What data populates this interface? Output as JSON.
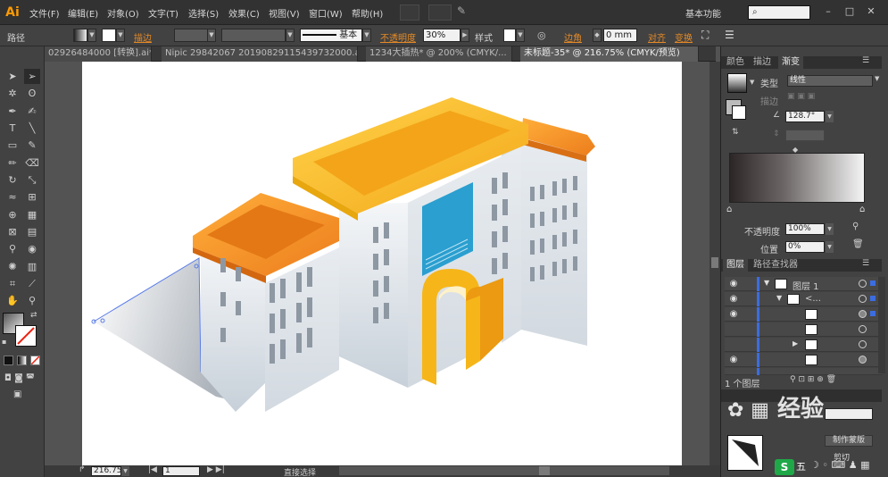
{
  "app": {
    "logo": "Ai",
    "menus": [
      "文件(F)",
      "编辑(E)",
      "对象(O)",
      "文字(T)",
      "选择(S)",
      "效果(C)",
      "视图(V)",
      "窗口(W)",
      "帮助(H)"
    ],
    "workspace": "基本功能",
    "search_placeholder": ""
  },
  "controlbar": {
    "path_label": "路径",
    "stroke_label": "描边",
    "stroke_style": "基本",
    "opacity_label": "不透明度",
    "opacity_value": "30%",
    "style_label": "样式",
    "corner_label": "边角",
    "corner_value": "0 mm",
    "align_label": "对齐",
    "transform_label": "变换"
  },
  "tabs": [
    {
      "label": "02926484000 [转换].ai*",
      "active": false
    },
    {
      "label": "Nipic 29842067 20190829115439732000.ai*",
      "active": false
    },
    {
      "label": "1234大插热* @ 200% (CMYK/...",
      "active": false
    },
    {
      "label": "未标题-35* @ 216.75% (CMYK/预览)",
      "active": true
    }
  ],
  "gradient_panel": {
    "tabs": [
      "颜色",
      "描边",
      "渐变"
    ],
    "type_label": "类型",
    "type_value": "线性",
    "stroke_label": "描边",
    "angle_value": "128.7°",
    "opacity_label": "不透明度",
    "opacity_value": "100%",
    "position_label": "位置",
    "position_value": "0%"
  },
  "layers_panel": {
    "tabs": [
      "图层",
      "路径查找器"
    ],
    "layer1": "图层 1",
    "sublayer": "<...",
    "count": "1 个图层"
  },
  "status": {
    "zoom": "216.75",
    "artboard": "1",
    "tool": "直接选择"
  },
  "watermark": "经验",
  "bottom_labels": {
    "make_mask": "制作蒙版",
    "clip": "剪切",
    "ime": "五"
  },
  "colors": {
    "orange_roof": "#f08a1c",
    "gold_roof": "#f6b619",
    "blue_panel": "#2a9fd0",
    "wall": "#e7ecf0"
  }
}
